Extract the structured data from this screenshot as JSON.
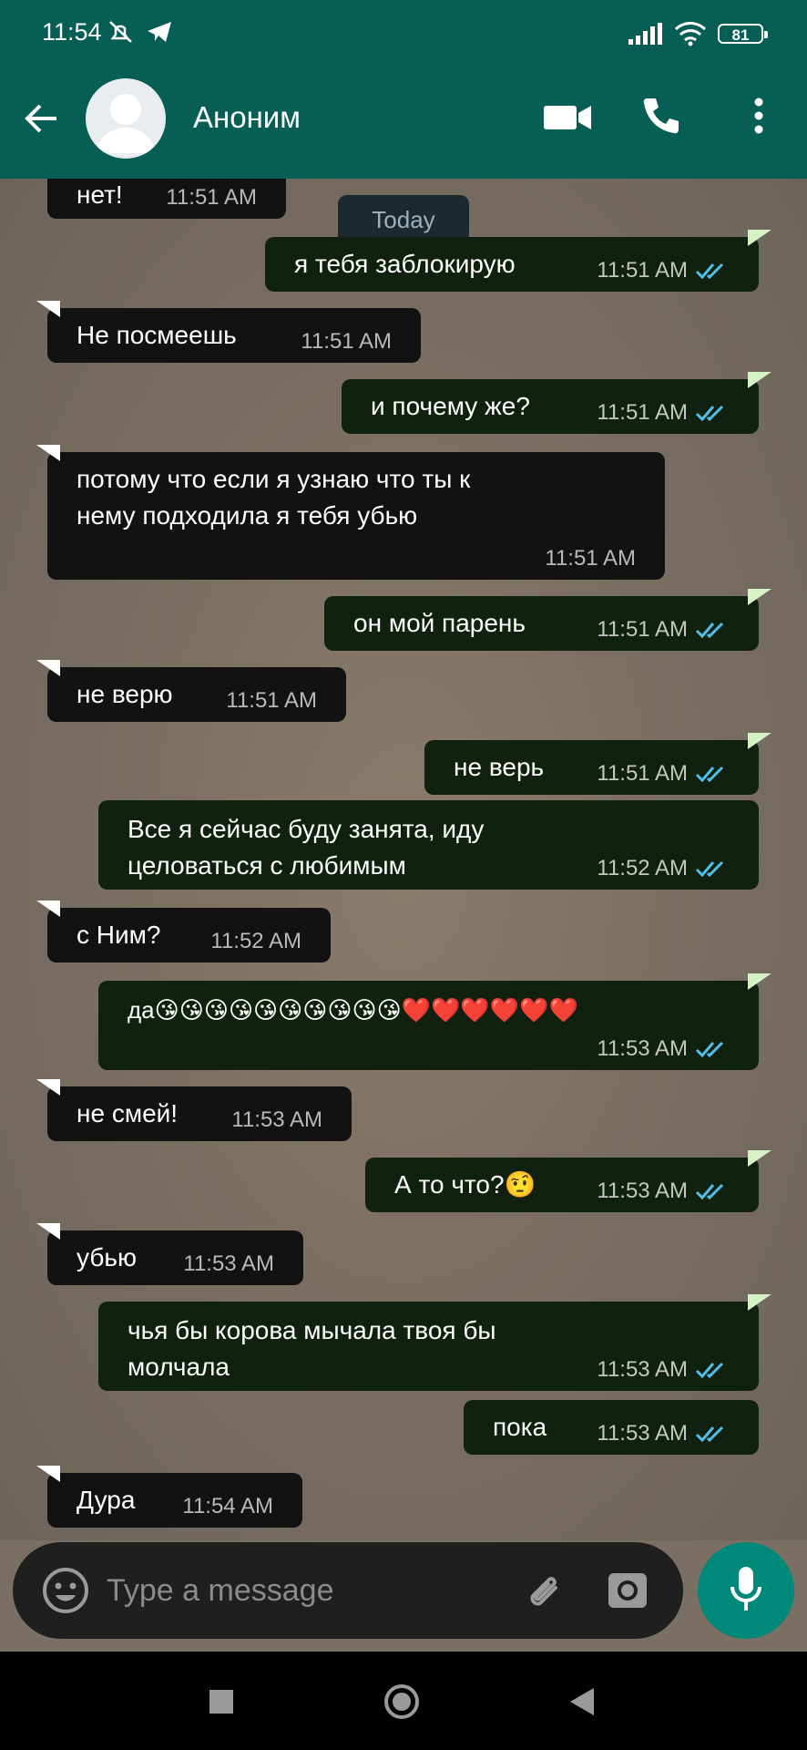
{
  "status_bar": {
    "time": "11:54",
    "battery": "81"
  },
  "header": {
    "contact_name": "Аноним"
  },
  "date_chip": "Today",
  "messages": [
    {
      "dir": "in",
      "text": "нет!",
      "time": "11:51 AM"
    },
    {
      "dir": "out",
      "text": "я тебя заблокирую",
      "time": "11:51 AM"
    },
    {
      "dir": "in",
      "text": "Не посмеешь",
      "time": "11:51 AM"
    },
    {
      "dir": "out",
      "text": "и почему же?",
      "time": "11:51 AM"
    },
    {
      "dir": "in",
      "text": "потому что если я узнаю что ты к нему подходила я тебя убью",
      "time": "11:51 AM"
    },
    {
      "dir": "out",
      "text": "он мой парень",
      "time": "11:51 AM"
    },
    {
      "dir": "in",
      "text": "не верю",
      "time": "11:51 AM"
    },
    {
      "dir": "out",
      "text": "не верь",
      "time": "11:51 AM"
    },
    {
      "dir": "out",
      "text": "Все я сейчас буду занята, иду целоваться с любимым",
      "time": "11:52 AM"
    },
    {
      "dir": "in",
      "text": "с Ним?",
      "time": "11:52 AM"
    },
    {
      "dir": "out",
      "text": "да😘😘😘😘😘😘😘😘😘😘❤️❤️❤️❤️❤️❤️",
      "time": "11:53 AM"
    },
    {
      "dir": "in",
      "text": "не смей!",
      "time": "11:53 AM"
    },
    {
      "dir": "out",
      "text": "А то что?🤨",
      "time": "11:53 AM"
    },
    {
      "dir": "in",
      "text": "убью",
      "time": "11:53 AM"
    },
    {
      "dir": "out",
      "text": "чья бы корова мычала твоя бы молчала",
      "time": "11:53 AM"
    },
    {
      "dir": "out",
      "text": "пока",
      "time": "11:53 AM"
    },
    {
      "dir": "in",
      "text": "Дура",
      "time": "11:54 AM"
    }
  ],
  "composer": {
    "placeholder": "Type a message"
  },
  "colors": {
    "header": "#075e54",
    "incoming": "#121212",
    "outgoing": "#10220f",
    "read_checks": "#53bdeb",
    "mic": "#00897b"
  },
  "icons": [
    "back-arrow-icon",
    "avatar-icon",
    "video-call-icon",
    "phone-icon",
    "more-vert-icon",
    "emoji-icon",
    "attach-icon",
    "camera-icon",
    "mic-icon"
  ]
}
